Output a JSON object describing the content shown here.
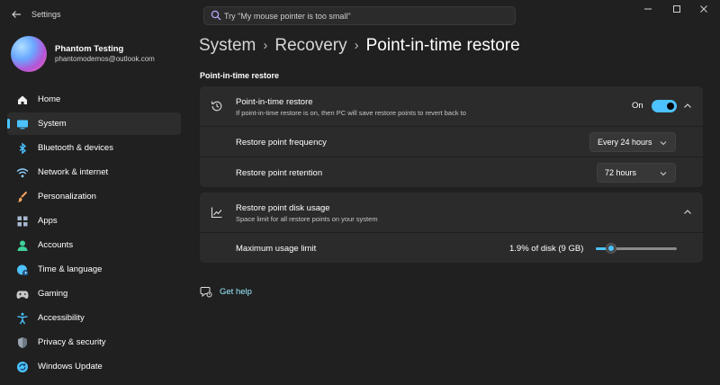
{
  "window": {
    "app_title": "Settings",
    "back_icon": "arrow-left-icon",
    "controls": [
      "minimize-icon",
      "maximize-icon",
      "close-icon"
    ]
  },
  "search": {
    "placeholder": "Try \"My mouse pointer is too small\"",
    "icon": "search-icon"
  },
  "profile": {
    "name": "Phantom Testing",
    "email": "phantomodemos@outlook.com"
  },
  "sidebar": {
    "items": [
      {
        "label": "Home",
        "icon": "home-icon",
        "color": "#f0f0f0"
      },
      {
        "label": "System",
        "icon": "system-icon",
        "color": "#4cc2ff"
      },
      {
        "label": "Bluetooth & devices",
        "icon": "bluetooth-icon",
        "color": "#4cc2ff"
      },
      {
        "label": "Network & internet",
        "icon": "wifi-icon",
        "color": "#8fd0ff"
      },
      {
        "label": "Personalization",
        "icon": "brush-icon",
        "color": "#f5a25d"
      },
      {
        "label": "Apps",
        "icon": "apps-icon",
        "color": "#a8b8d0"
      },
      {
        "label": "Accounts",
        "icon": "person-icon",
        "color": "#3ed09a"
      },
      {
        "label": "Time & language",
        "icon": "globe-clock-icon",
        "color": "#4cc2ff"
      },
      {
        "label": "Gaming",
        "icon": "gamepad-icon",
        "color": "#c8c8c8"
      },
      {
        "label": "Accessibility",
        "icon": "accessibility-icon",
        "color": "#4cc2ff"
      },
      {
        "label": "Privacy & security",
        "icon": "shield-icon",
        "color": "#9aa4b0"
      },
      {
        "label": "Windows Update",
        "icon": "update-icon",
        "color": "#4cc2ff"
      }
    ],
    "active_index": 1
  },
  "breadcrumb": {
    "parts": [
      "System",
      "Recovery",
      "Point-in-time restore"
    ]
  },
  "section_title": "Point-in-time restore",
  "restore_card": {
    "title": "Point-in-time restore",
    "description": "If point-in-time restore is on, then PC will save restore points to revert back to",
    "toggle_label": "On",
    "toggle_on": true,
    "icon": "restore-clock-icon",
    "rows": [
      {
        "label": "Restore point frequency",
        "value": "Every 24 hours"
      },
      {
        "label": "Restore point retention",
        "value": "72 hours"
      }
    ]
  },
  "disk_card": {
    "title": "Restore point disk usage",
    "description": "Space limit for all restore points on your system",
    "icon": "chart-line-icon",
    "row_label": "Maximum usage limit",
    "value_text": "1.9% of disk (9 GB)",
    "slider_fraction": 0.19
  },
  "help": {
    "label": "Get help",
    "icon": "help-chat-icon"
  },
  "colors": {
    "accent": "#4cc2ff",
    "background": "#202020",
    "card": "#2b2b2b",
    "link": "#99ebff"
  }
}
